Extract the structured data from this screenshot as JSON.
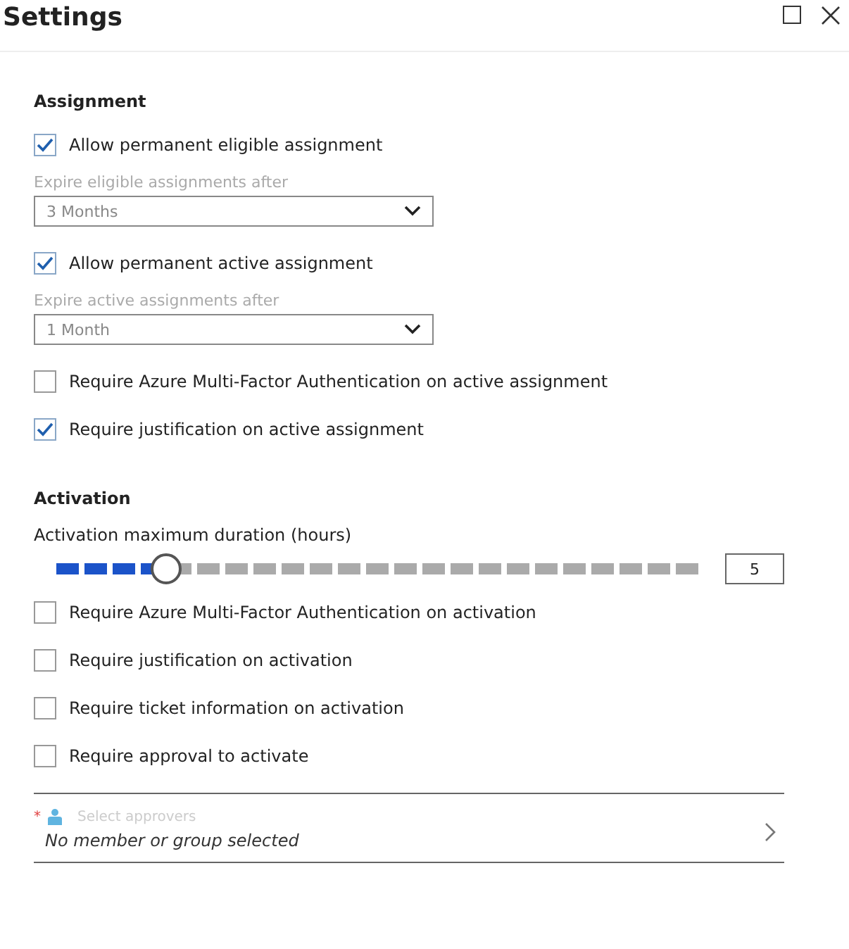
{
  "window": {
    "title": "Settings"
  },
  "sections": [
    {
      "heading": "Assignment",
      "items": [
        {
          "kind": "checkbox",
          "label": "Allow permanent eligible assignment",
          "checked": true
        },
        {
          "kind": "dropdown",
          "label": "Expire eligible assignments after",
          "value": "3 Months"
        },
        {
          "kind": "checkbox",
          "label": "Allow permanent active assignment",
          "checked": true
        },
        {
          "kind": "dropdown",
          "label": "Expire active assignments after",
          "value": "1 Month"
        },
        {
          "kind": "checkbox",
          "label": "Require Azure Multi-Factor Authentication on active assignment",
          "checked": false
        },
        {
          "kind": "checkbox",
          "label": "Require justification on active assignment",
          "checked": true
        }
      ]
    },
    {
      "heading": "Activation",
      "items": [
        {
          "kind": "slider",
          "label": "Activation maximum duration (hours)",
          "level": 0.17,
          "reading": "5"
        },
        {
          "kind": "checkbox",
          "label": "Require Azure Multi-Factor Authentication on activation",
          "checked": false
        },
        {
          "kind": "checkbox",
          "label": "Require justification on activation",
          "checked": false
        },
        {
          "kind": "checkbox",
          "label": "Require ticket information on activation",
          "checked": false
        },
        {
          "kind": "checkbox",
          "label": "Require approval to activate",
          "checked": false
        },
        {
          "kind": "picker",
          "required_mark": "*",
          "placeholder": "Select approvers",
          "value": "No member or group selected"
        }
      ]
    }
  ]
}
